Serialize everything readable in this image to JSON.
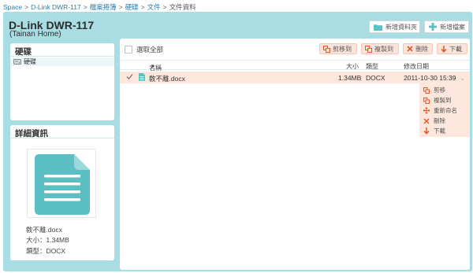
{
  "breadcrumb": [
    "Space",
    "D-Link DWR-117",
    "檔案捲簿",
    "硬碟",
    "文件",
    "文件資料"
  ],
  "device": {
    "title": "D-Link DWR-117",
    "subtitle": "(Tainan Home)"
  },
  "toolbar": {
    "new_folder": "新增資料夾",
    "new_file": "新增檔案"
  },
  "sidebar": {
    "disk_header": "硬碟",
    "tree": [
      {
        "label": "硬碟",
        "icon": "drive-icon"
      }
    ],
    "details_header": "詳細資訊",
    "details": {
      "icon": "document-icon",
      "name": "敎不離.docx",
      "size_label": "大小：",
      "size": "1.34MB",
      "type_label": "類型：",
      "type": "DOCX"
    }
  },
  "files": {
    "select_all": "選取全部",
    "actions": {
      "move": "剪移到",
      "copy": "複製到",
      "delete": "刪除",
      "download": "下載"
    },
    "columns": {
      "name": "名稱",
      "size": "大小",
      "type": "類型",
      "date": "修改日期"
    },
    "sort_indicator": "▲",
    "rows": [
      {
        "name": "敎不離.docx",
        "size": "1.34MB",
        "type": "DOCX",
        "modified": "2011-10-30 15:39",
        "selected": true
      }
    ],
    "row_menu_glyph": "⌄",
    "context_menu": [
      {
        "label": "剪移",
        "icon": "move-icon"
      },
      {
        "label": "複製到",
        "icon": "copy-icon"
      },
      {
        "label": "重新命名",
        "icon": "rename-icon"
      },
      {
        "label": "刪除",
        "icon": "delete-icon"
      },
      {
        "label": "下載",
        "icon": "download-icon"
      }
    ]
  },
  "colors": {
    "panel": "#a9dde4",
    "accent": "#2a7fa8",
    "selection": "#fde6dc",
    "action_icon": "#e8572b",
    "doc_icon": "#5cbfc4"
  }
}
